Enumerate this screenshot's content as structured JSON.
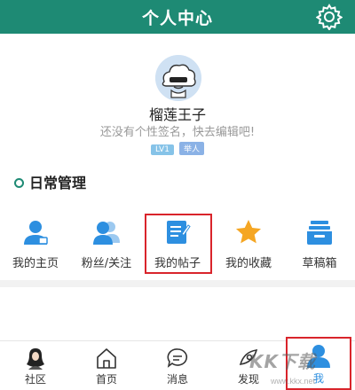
{
  "header": {
    "title": "个人中心",
    "settings_icon": "gear-icon"
  },
  "profile": {
    "avatar_icon": "cloud-avatar-icon",
    "username": "榴莲王子",
    "signature": "还没有个性签名，快去编辑吧!",
    "level_badge": "LV1",
    "role_badge": "举人"
  },
  "section": {
    "title": "日常管理"
  },
  "grid": [
    {
      "label": "我的主页",
      "icon": "homepage-user-icon"
    },
    {
      "label": "粉丝/关注",
      "icon": "followers-icon"
    },
    {
      "label": "我的帖子",
      "icon": "posts-document-icon"
    },
    {
      "label": "我的收藏",
      "icon": "star-icon"
    },
    {
      "label": "草稿箱",
      "icon": "drafts-tray-icon"
    }
  ],
  "tabs": [
    {
      "label": "社区",
      "icon": "community-icon"
    },
    {
      "label": "首页",
      "icon": "home-icon"
    },
    {
      "label": "消息",
      "icon": "message-icon"
    },
    {
      "label": "发现",
      "icon": "discover-icon"
    },
    {
      "label": "我",
      "icon": "profile-icon",
      "active": true
    }
  ],
  "watermark": {
    "text": "KK下载",
    "sub": "www.kkx.net"
  },
  "colors": {
    "brand": "#1e8a74",
    "highlight": "#d9242b",
    "icon_blue": "#2d8fe0",
    "star": "#f5a623"
  }
}
